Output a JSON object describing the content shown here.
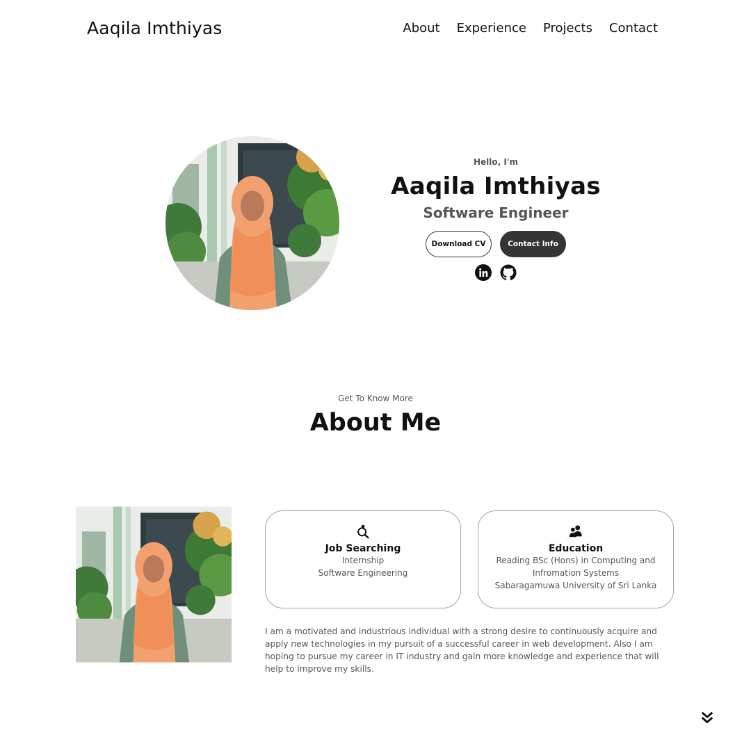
{
  "nav": {
    "logo": "Aaqila Imthiyas",
    "links": [
      "About",
      "Experience",
      "Projects",
      "Contact"
    ]
  },
  "hero": {
    "greeting": "Hello, I'm",
    "name": "Aaqila Imthiyas",
    "role": "Software Engineer",
    "download_cv": "Download CV",
    "contact_info": "Contact Info",
    "social_icons": [
      "linkedin-icon",
      "github-icon"
    ]
  },
  "about": {
    "subtitle": "Get To Know More",
    "title": "About Me",
    "cards": [
      {
        "icon": "job-search-icon",
        "title": "Job Searching",
        "lines": [
          "Internship",
          "Software Engineering"
        ]
      },
      {
        "icon": "education-icon",
        "title": "Education",
        "lines": [
          "Reading BSc (Hons) in Computing and",
          "Infromation Systems",
          "Sabaragamuwa University of Sri Lanka"
        ]
      }
    ],
    "bio": "I am a motivated and industrious individual with a strong desire to continuously acquire and apply new technologies in my pursuit of a successful career in web development. Also I am hoping to pursue my career in IT industry and gain more knowledge and experience that will help to improve my skills."
  },
  "colors": {
    "text": "#111111",
    "muted": "#555555",
    "dark_button": "#353535",
    "card_border": "#a3a3a3",
    "scarf": "#f2a06e"
  }
}
